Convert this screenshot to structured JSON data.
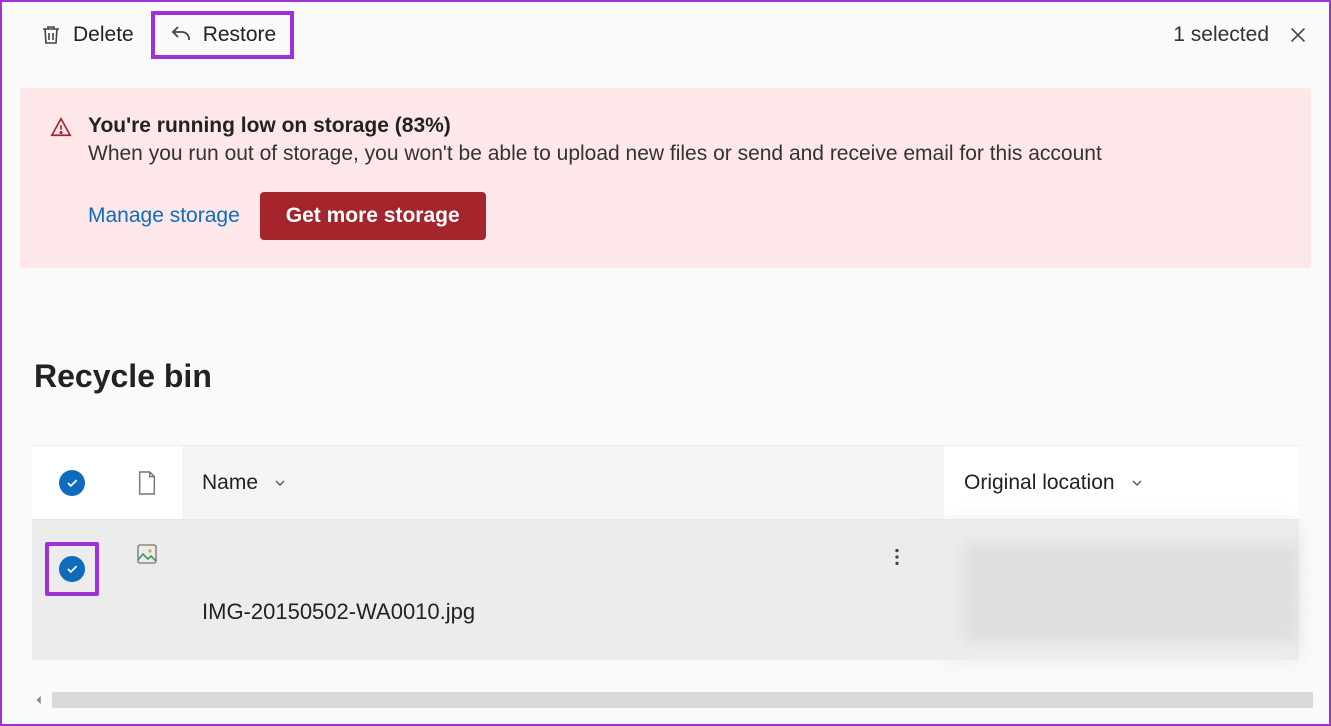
{
  "toolbar": {
    "delete_label": "Delete",
    "restore_label": "Restore",
    "selection_text": "1 selected"
  },
  "alert": {
    "title": "You're running low on storage (83%)",
    "body": "When you run out of storage, you won't be able to upload new files or send and receive email for this account",
    "manage_label": "Manage storage",
    "getmore_label": "Get more storage"
  },
  "page": {
    "title": "Recycle bin"
  },
  "table": {
    "columns": {
      "name": "Name",
      "original_location": "Original location"
    },
    "rows": [
      {
        "selected": true,
        "icon": "image",
        "name": "IMG-20150502-WA0010.jpg",
        "original_location": "(redacted)"
      }
    ]
  }
}
